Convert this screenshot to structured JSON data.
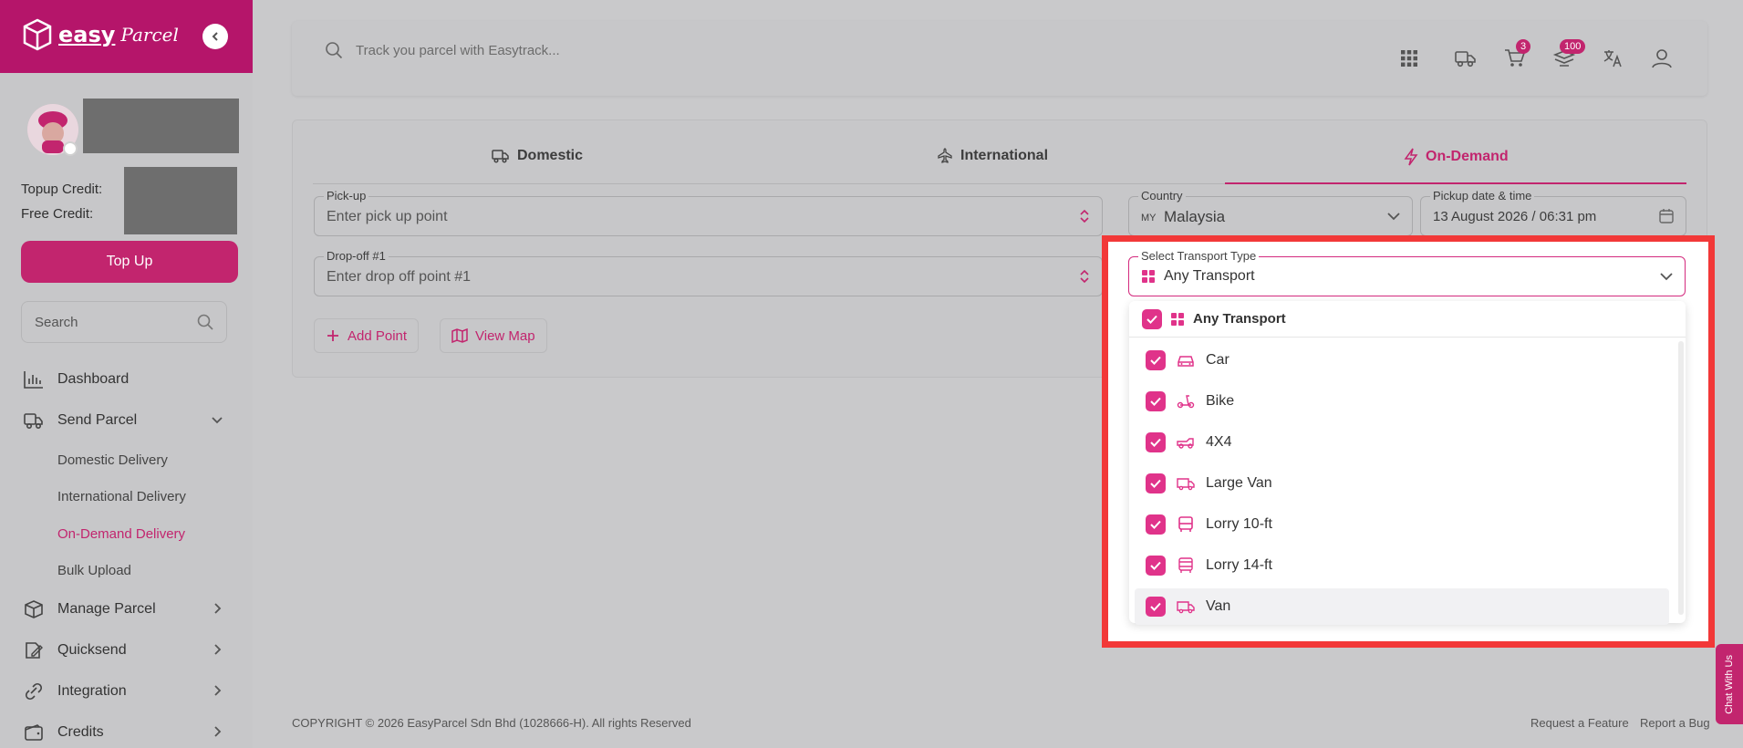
{
  "brand": {
    "name": "easy",
    "script": "Parcel",
    "accent": "#c2256e"
  },
  "sidebar": {
    "credits": {
      "topup_label": "Topup Credit:",
      "free_label": "Free Credit:"
    },
    "topup_button": "Top Up",
    "search_placeholder": "Search",
    "nav": [
      {
        "label": "Dashboard",
        "icon": "chart-bars-icon"
      },
      {
        "label": "Send Parcel",
        "icon": "truck-icon"
      },
      {
        "label": "Manage Parcel",
        "icon": "box-icon"
      },
      {
        "label": "Quicksend",
        "icon": "edit-icon"
      },
      {
        "label": "Integration",
        "icon": "link-icon"
      },
      {
        "label": "Credits",
        "icon": "wallet-icon"
      }
    ],
    "send_parcel_sub": [
      "Domestic Delivery",
      "International Delivery",
      "On-Demand Delivery",
      "Bulk Upload"
    ]
  },
  "header": {
    "track_placeholder": "Track you parcel with Easytrack...",
    "cart_badge": "3",
    "notification_badge": "100"
  },
  "tabs": [
    {
      "label": "Domestic",
      "icon": "truck-icon"
    },
    {
      "label": "International",
      "icon": "plane-icon"
    },
    {
      "label": "On-Demand",
      "icon": "lightning-icon"
    }
  ],
  "form": {
    "pickup": {
      "label": "Pick-up",
      "placeholder": "Enter pick up point"
    },
    "dropoff": {
      "label": "Drop-off #1",
      "placeholder": "Enter drop off point #1"
    },
    "country": {
      "label": "Country",
      "code": "MY",
      "value": "Malaysia"
    },
    "pickup_datetime": {
      "label": "Pickup date & time",
      "value": "13 August 2026 /  06:31 pm"
    },
    "add_point": "Add Point",
    "view_map": "View Map"
  },
  "transport": {
    "label": "Select Transport Type",
    "value": "Any Transport",
    "all_option": "Any Transport",
    "options": [
      {
        "label": "Car",
        "icon": "car-icon",
        "checked": true
      },
      {
        "label": "Bike",
        "icon": "scooter-icon",
        "checked": true
      },
      {
        "label": "4X4",
        "icon": "4x4-icon",
        "checked": true
      },
      {
        "label": "Large Van",
        "icon": "van-icon",
        "checked": true
      },
      {
        "label": "Lorry 10-ft",
        "icon": "bus-icon",
        "checked": true
      },
      {
        "label": "Lorry 14-ft",
        "icon": "lorry-icon",
        "checked": true
      },
      {
        "label": "Van",
        "icon": "van-icon",
        "checked": true
      }
    ]
  },
  "footer": {
    "copyright": "COPYRIGHT © 2026 EasyParcel Sdn Bhd (1028666-H). All rights Reserved",
    "request_feature": "Request a Feature",
    "report_bug": "Report a Bug",
    "chat": "Chat With Us"
  }
}
